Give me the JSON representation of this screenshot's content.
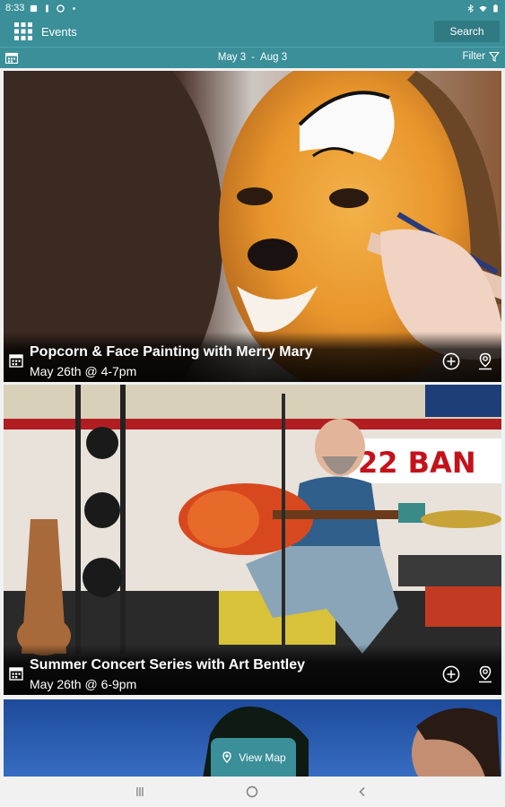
{
  "status_bar": {
    "time": "8:33"
  },
  "app_bar": {
    "title": "Events",
    "search_label": "Search"
  },
  "date_bar": {
    "start": "May 3",
    "separator": "-",
    "end": "Aug 3",
    "filter_label": "Filter"
  },
  "events": [
    {
      "title": "Popcorn & Face Painting with Merry Mary",
      "date": "May 26th @ 4-7pm",
      "image": "child-face-painting-photo"
    },
    {
      "title": "Summer Concert Series with Art Bentley",
      "date": "May 26th @ 6-9pm",
      "image": "guitarist-performing-photo"
    },
    {
      "image": "evening-sky-girl-photo"
    }
  ],
  "view_map": {
    "label": "View Map"
  },
  "icons": {
    "menu": "apps-grid-icon",
    "calendar": "calendar-icon",
    "filter": "filter-icon",
    "add": "add-circle-icon",
    "map_pin": "map-pin-icon",
    "nav_recents": "recents-icon",
    "nav_home": "home-icon",
    "nav_back": "back-icon"
  },
  "colors": {
    "primary": "#3a8f99",
    "primary_dark": "#2f7a83",
    "caption_text": "#ffffff",
    "nav_bg": "#f1f1f1"
  }
}
